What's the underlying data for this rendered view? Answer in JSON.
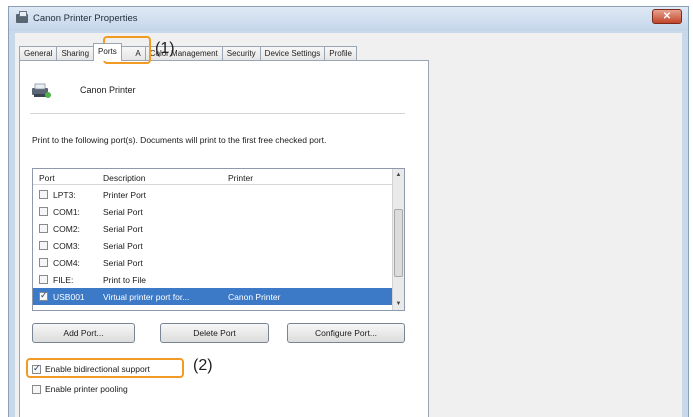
{
  "window": {
    "title": "Canon Printer Properties",
    "close_label": "✕"
  },
  "tabs": [
    {
      "label": "General"
    },
    {
      "label": "Sharing"
    },
    {
      "label": "Ports"
    },
    {
      "label": "A"
    },
    {
      "label": "Color Management"
    },
    {
      "label": "Security"
    },
    {
      "label": "Device Settings"
    },
    {
      "label": "Profile"
    }
  ],
  "printer": {
    "name": "Canon Printer"
  },
  "instruction": "Print to the following port(s). Documents will print to the first free checked port.",
  "port_list": {
    "headers": {
      "port": "Port",
      "description": "Description",
      "printer": "Printer"
    },
    "rows": [
      {
        "port": "LPT3:",
        "description": "Printer Port",
        "printer": "",
        "checked": false
      },
      {
        "port": "COM1:",
        "description": "Serial Port",
        "printer": "",
        "checked": false
      },
      {
        "port": "COM2:",
        "description": "Serial Port",
        "printer": "",
        "checked": false
      },
      {
        "port": "COM3:",
        "description": "Serial Port",
        "printer": "",
        "checked": false
      },
      {
        "port": "COM4:",
        "description": "Serial Port",
        "printer": "",
        "checked": false
      },
      {
        "port": "FILE:",
        "description": "Print to File",
        "printer": "",
        "checked": false
      },
      {
        "port": "USB001",
        "description": "Virtual printer port for...",
        "printer": "Canon Printer",
        "checked": true,
        "selected": true
      }
    ]
  },
  "buttons": {
    "add_port": "Add Port...",
    "delete_port": "Delete Port",
    "configure_port": "Configure Port..."
  },
  "options": {
    "bidirectional": {
      "label": "Enable bidirectional support",
      "checked": true
    },
    "pooling": {
      "label": "Enable printer pooling",
      "checked": false
    }
  },
  "callouts": {
    "one": "(1)",
    "two": "(2)"
  },
  "colors": {
    "highlight": "#f29b22",
    "selection": "#3c79c7"
  }
}
